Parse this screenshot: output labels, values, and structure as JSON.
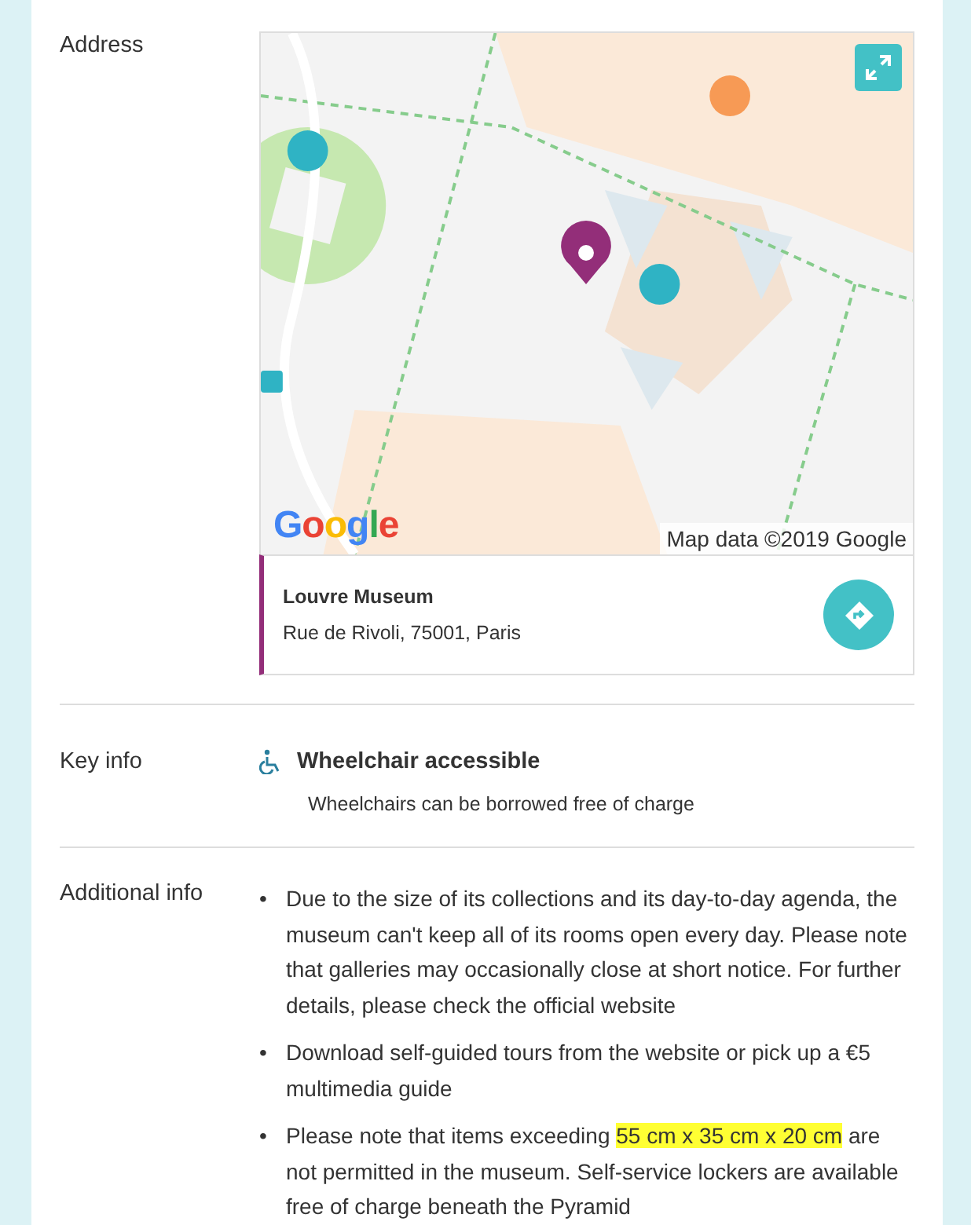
{
  "sections": [
    {
      "kind": "address",
      "label": "Address",
      "map": {
        "attribution": "Map data ©2019 Google",
        "logo": "Google"
      },
      "place": {
        "name": "Louvre Museum",
        "address": "Rue de Rivoli, 75001, Paris"
      }
    },
    {
      "kind": "key_info",
      "label": "Key info",
      "items": [
        {
          "title": "Wheelchair accessible",
          "detail": "Wheelchairs can be borrowed free of charge"
        }
      ]
    },
    {
      "kind": "list",
      "label": "Additional info",
      "items": [
        {
          "bullet": "•",
          "parts": [
            {
              "text": "Due to the size of its collections and its day-to-day agenda, the museum can't keep all of its rooms open every day. Please note that galleries may occasionally close at short notice. For further details, please check the official website",
              "highlighted": false
            }
          ]
        },
        {
          "bullet": "•",
          "parts": [
            {
              "text": "Download self-guided tours from the website or pick up a €5 multimedia guide",
              "highlighted": false
            }
          ]
        },
        {
          "bullet": "•",
          "parts": [
            {
              "text": "Please note that items exceeding ",
              "highlighted": false
            },
            {
              "text": "55 cm x 35 cm x 20 cm",
              "highlighted": true
            },
            {
              "text": " are not permitted in the museum. Self-service lockers are available free of charge beneath the Pyramid",
              "highlighted": false
            }
          ]
        }
      ]
    }
  ]
}
